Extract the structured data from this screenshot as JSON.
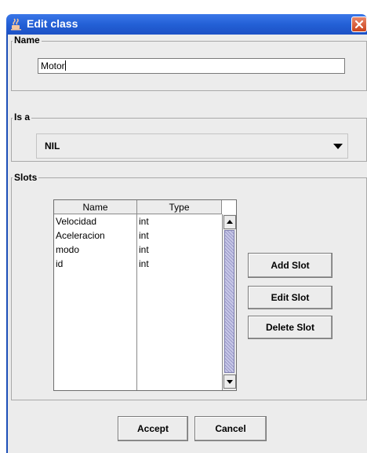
{
  "window": {
    "title": "Edit class"
  },
  "name_section": {
    "legend": "Name",
    "value": "Motor"
  },
  "isa_section": {
    "legend": "Is a",
    "selected": "NIL"
  },
  "slots_section": {
    "legend": "Slots",
    "columns": [
      "Name",
      "Type"
    ],
    "rows": [
      {
        "name": "Velocidad",
        "type": "int"
      },
      {
        "name": "Aceleracion",
        "type": "int"
      },
      {
        "name": "modo",
        "type": "int"
      },
      {
        "name": "id",
        "type": "int"
      }
    ],
    "add_label": "Add Slot",
    "edit_label": "Edit Slot",
    "delete_label": "Delete Slot"
  },
  "footer": {
    "accept_label": "Accept",
    "cancel_label": "Cancel"
  },
  "colors": {
    "titlebar": "#2360d6",
    "close": "#c9421c",
    "dialog_bg": "#ececec",
    "scroll_thumb": "#9a9ac8"
  },
  "icons": {
    "title": "app-coffee-icon",
    "close": "close-icon",
    "dropdown": "chevron-down-icon",
    "scroll_up": "arrow-up-icon",
    "scroll_down": "arrow-down-icon"
  }
}
